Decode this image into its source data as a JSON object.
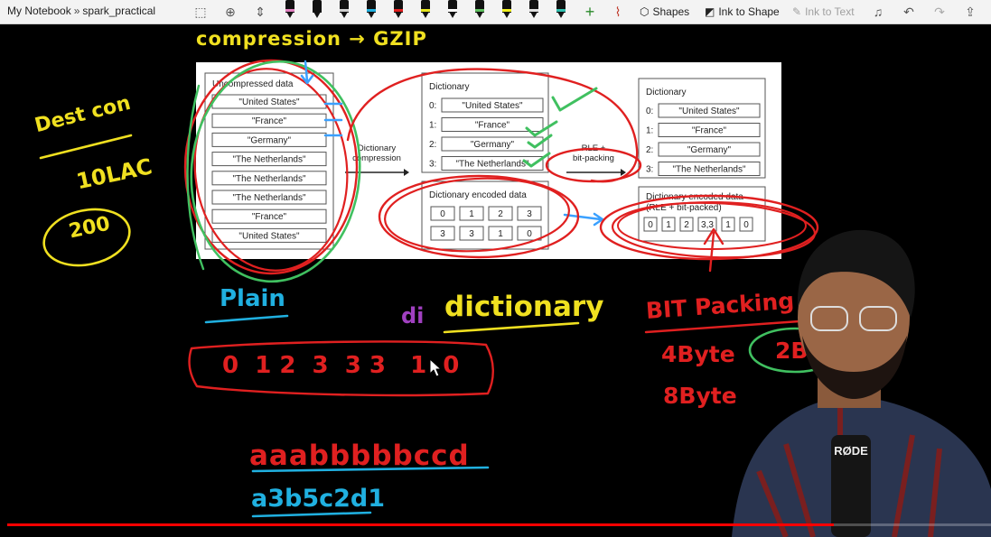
{
  "toolbar": {
    "notebook": "My Notebook",
    "separator": "»",
    "section": "spark_practical",
    "shapes_label": "Shapes",
    "ink_to_shape_label": "Ink to Shape",
    "ink_to_text_label": "Ink to Text",
    "pen_colors": [
      "#e080c0",
      "#111111",
      "#d0d0d0",
      "#20b0e0",
      "#e02020",
      "#e8e820",
      "#ffffff",
      "#60c060",
      "#f0f020",
      "#e0e0e0",
      "#30c0b0"
    ]
  },
  "figure": {
    "uncompressed_title": "Uncompressed data",
    "uncompressed": [
      "\"United States\"",
      "\"France\"",
      "\"Germany\"",
      "\"The Netherlands\"",
      "\"The Netherlands\"",
      "\"The Netherlands\"",
      "\"France\"",
      "\"United States\""
    ],
    "arrow1": "Dictionary\ncompression",
    "dict_title": "Dictionary",
    "dict_idx": [
      "0:",
      "1:",
      "2:",
      "3:"
    ],
    "dict_vals": [
      "\"United States\"",
      "\"France\"",
      "\"Germany\"",
      "\"The Netherlands\""
    ],
    "encoded_title": "Dictionary encoded data",
    "encoded_row1": [
      "0",
      "1",
      "2",
      "3"
    ],
    "encoded_row2": [
      "3",
      "3",
      "1",
      "0"
    ],
    "arrow2": "RLE +\nbit-packing",
    "dict2_title": "Dictionary",
    "packed_title": "Dictionary encoded data",
    "packed_sub": "(RLE + bit-packed)",
    "packed": [
      "0",
      "1",
      "2",
      "3,3",
      "1",
      "0"
    ]
  },
  "handwriting": {
    "compression": "compression → GZIP",
    "dest_con": "Dest con",
    "ten_lac": "10LAC",
    "two_hundred": "200",
    "plain": "Plain",
    "di": "di",
    "dictionary": "dictionary",
    "sequence": "0  1 2  3  3 3   1  0",
    "raw": "aaabbbbbccd",
    "rle": "a3b5c2d1",
    "bit_packing": "BIT Packing",
    "four_byte": "4Byte",
    "eight_byte": "8Byte",
    "two_b": "2B"
  },
  "video": {
    "progress": 0.84,
    "mic_brand": "RØDE"
  }
}
